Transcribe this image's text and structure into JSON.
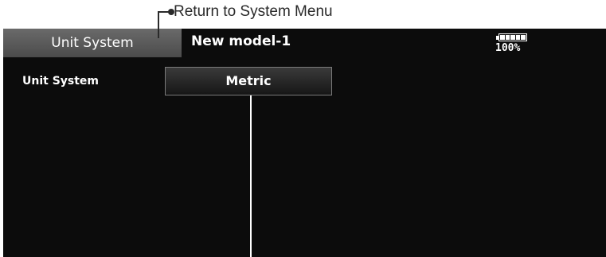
{
  "annotation": {
    "return_label": "Return to System Menu"
  },
  "header": {
    "tab_title": "Unit System",
    "model_name": "New model-1",
    "battery_percent": "100%",
    "battery_level": 1.0
  },
  "settings": {
    "row_label": "Unit System",
    "value": "Metric"
  },
  "colors": {
    "screen_bg": "#0c0c0c",
    "tab_bg": "#5a5a5a",
    "text": "#ffffff"
  }
}
